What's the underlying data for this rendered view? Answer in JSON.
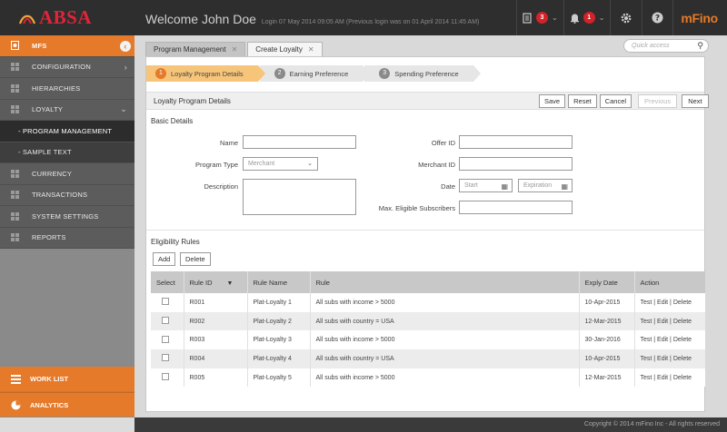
{
  "header": {
    "brand": "ABSA",
    "welcome": "Welcome John Doe",
    "login_info": "Login 07 May 2014 09:05 AM (Previous login was on 01 April 2014 11:45 AM)",
    "tasks_count": "3",
    "alerts_count": "1",
    "product": "mFino",
    "icons": [
      "tasks-icon",
      "bell-icon",
      "gear-icon",
      "help-icon"
    ]
  },
  "sidebar": {
    "items": [
      {
        "label": "MFS"
      },
      {
        "label": "CONFIGURATION"
      },
      {
        "label": "HIERARCHIES"
      },
      {
        "label": "LOYALTY"
      },
      {
        "label": "- PROGRAM MANAGEMENT"
      },
      {
        "label": "- SAMPLE TEXT"
      },
      {
        "label": "CURRENCY"
      },
      {
        "label": "TRANSACTIONS"
      },
      {
        "label": "SYSTEM SETTINGS"
      },
      {
        "label": "REPORTS"
      }
    ],
    "work_list": "WORK LIST",
    "analytics": "ANALYTICS"
  },
  "tabs": [
    {
      "label": "Program Management"
    },
    {
      "label": "Create Loyalty"
    }
  ],
  "search": {
    "placeholder": "Quick access"
  },
  "steps": [
    {
      "num": "1",
      "label": "Loyalty Program Details"
    },
    {
      "num": "2",
      "label": "Earning Preference"
    },
    {
      "num": "3",
      "label": "Spending Preference"
    }
  ],
  "panel": {
    "title": "Loyalty Program Details",
    "save": "Save",
    "reset": "Reset",
    "cancel": "Cancel",
    "previous": "Previous",
    "next": "Next"
  },
  "basic": {
    "title": "Basic Details",
    "name_label": "Name",
    "name_value": "",
    "program_type_label": "Program Type",
    "program_type_value": "Merchant",
    "description_label": "Description",
    "offer_id_label": "Offer ID",
    "merchant_id_label": "Merchant ID",
    "date_label": "Date",
    "start_placeholder": "Start",
    "expiration_placeholder": "Expiration",
    "max_subscribers_label": "Max. Eligible Subscribers"
  },
  "eligibility": {
    "title": "Eligibility Rules",
    "add": "Add",
    "delete": "Delete",
    "columns": [
      "Select",
      "Rule ID",
      "Rule Name",
      "Rule",
      "Exply Date",
      "Action"
    ],
    "rows": [
      {
        "id": "R001",
        "name": "Plat-Loyalty 1",
        "rule": "All subs with income > 5000",
        "date": "10-Apr-2015",
        "action": "Test | Edit | Delete"
      },
      {
        "id": "R002",
        "name": "Plat-Loyalty 2",
        "rule": "All subs with country = USA",
        "date": "12-Mar-2015",
        "action": "Test | Edit | Delete"
      },
      {
        "id": "R003",
        "name": "Plat-Loyalty 3",
        "rule": "All subs with income > 5000",
        "date": "30-Jan-2016",
        "action": "Test | Edit | Delete"
      },
      {
        "id": "R004",
        "name": "Plat-Loyalty 4",
        "rule": "All subs with country = USA",
        "date": "10-Apr-2015",
        "action": "Test | Edit | Delete"
      },
      {
        "id": "R005",
        "name": "Plat-Loyalty 5",
        "rule": "All subs with income > 5000",
        "date": "12-Mar-2015",
        "action": "Test | Edit | Delete"
      }
    ]
  },
  "footer": "Copyright © 2014 mFino Inc - All rights reserved",
  "colors": {
    "accent": "#e57a2a",
    "brand_red": "#e0243a",
    "badge": "#d3222a"
  }
}
